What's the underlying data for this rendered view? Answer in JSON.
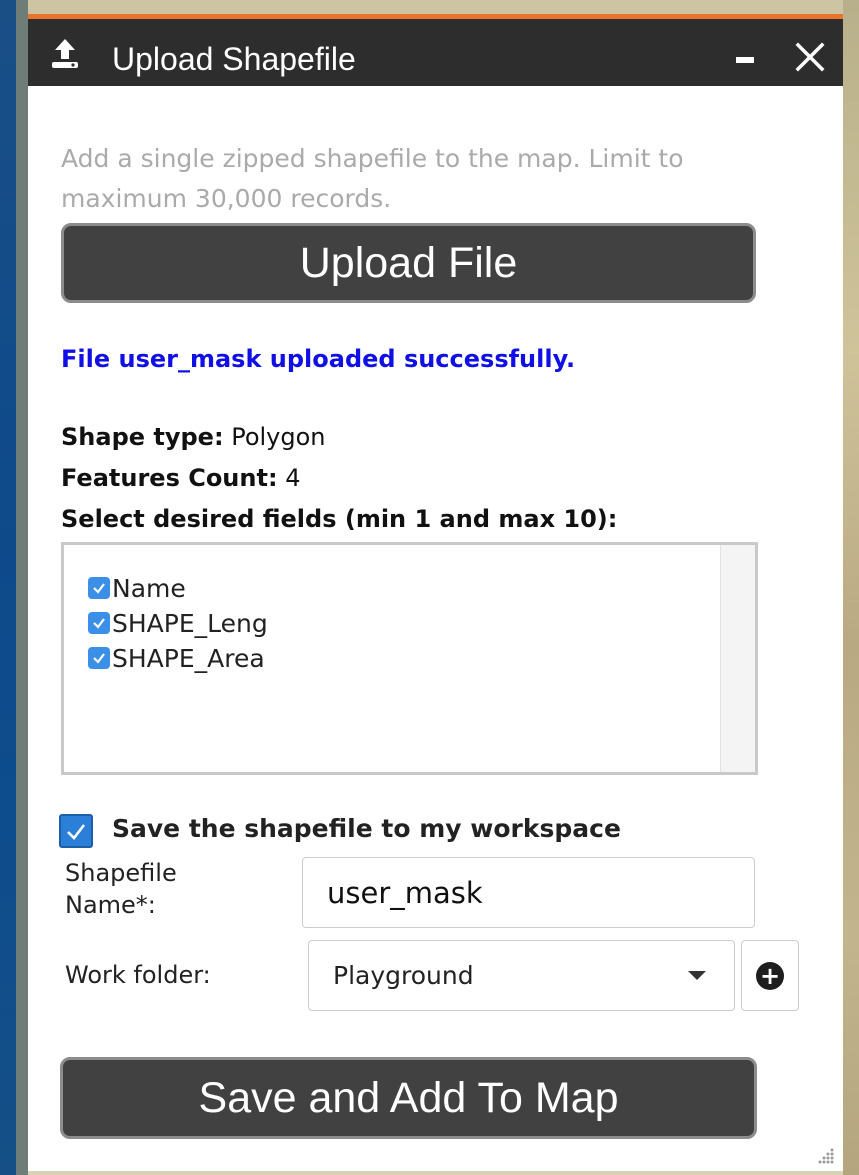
{
  "dialog": {
    "title": "Upload Shapefile",
    "icons": {
      "title": "upload-icon",
      "minimize": "minimize-icon",
      "close": "close-icon",
      "add": "plus-circle-icon",
      "dropdown": "chevron-down-icon"
    },
    "accent_color": "#e8752b"
  },
  "upload": {
    "description": "Add a single zipped shapefile to the map. Limit to maximum 30,000 records.",
    "button_label": "Upload File",
    "status_message": "File user_mask uploaded successfully.",
    "status_color": "#1010e6"
  },
  "info": {
    "shape_type_label": "Shape type:",
    "shape_type_value": "Polygon",
    "features_count_label": "Features Count:",
    "features_count_value": "4",
    "select_fields_label": "Select desired fields (min 1 and max 10):"
  },
  "fields": [
    {
      "name": "Name",
      "checked": true
    },
    {
      "name": "SHAPE_Leng",
      "checked": true
    },
    {
      "name": "SHAPE_Area",
      "checked": true
    }
  ],
  "save_option": {
    "label": "Save the shapefile to my workspace",
    "checked": true
  },
  "form": {
    "name_label_line1": "Shapefile",
    "name_label_line2": "Name*:",
    "name_value": "user_mask",
    "folder_label": "Work folder:",
    "folder_value": "Playground"
  },
  "actions": {
    "save_button_label": "Save and Add To Map"
  }
}
